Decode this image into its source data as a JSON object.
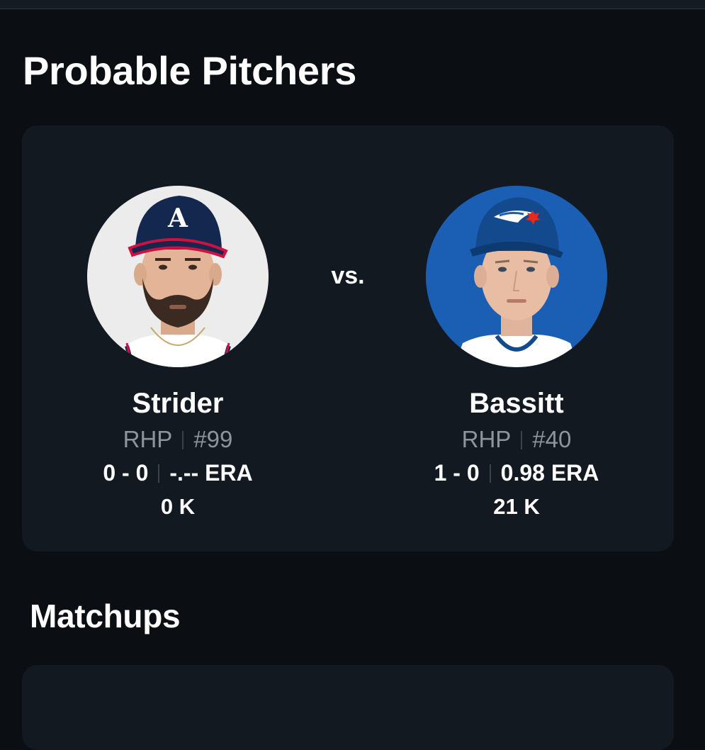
{
  "sections": {
    "probable_pitchers_title": "Probable Pitchers",
    "matchups_title": "Matchups"
  },
  "probable_pitchers": {
    "vs_label": "vs.",
    "home": {
      "name": "Strider",
      "hand": "RHP",
      "number": "#99",
      "record": "0 - 0",
      "era": "-.-- ERA",
      "strikeouts": "0 K",
      "team_logo_icon": "braves-a-cap-icon"
    },
    "away": {
      "name": "Bassitt",
      "hand": "RHP",
      "number": "#40",
      "record": "1 - 0",
      "era": "0.98 ERA",
      "strikeouts": "21 K",
      "team_logo_icon": "blue-jays-cap-icon"
    }
  },
  "colors": {
    "background": "#0b0f14",
    "card": "#131920",
    "muted_text": "#8d949c",
    "braves_navy": "#13274f",
    "braves_red": "#ce1141",
    "jays_blue": "#134a8e"
  }
}
